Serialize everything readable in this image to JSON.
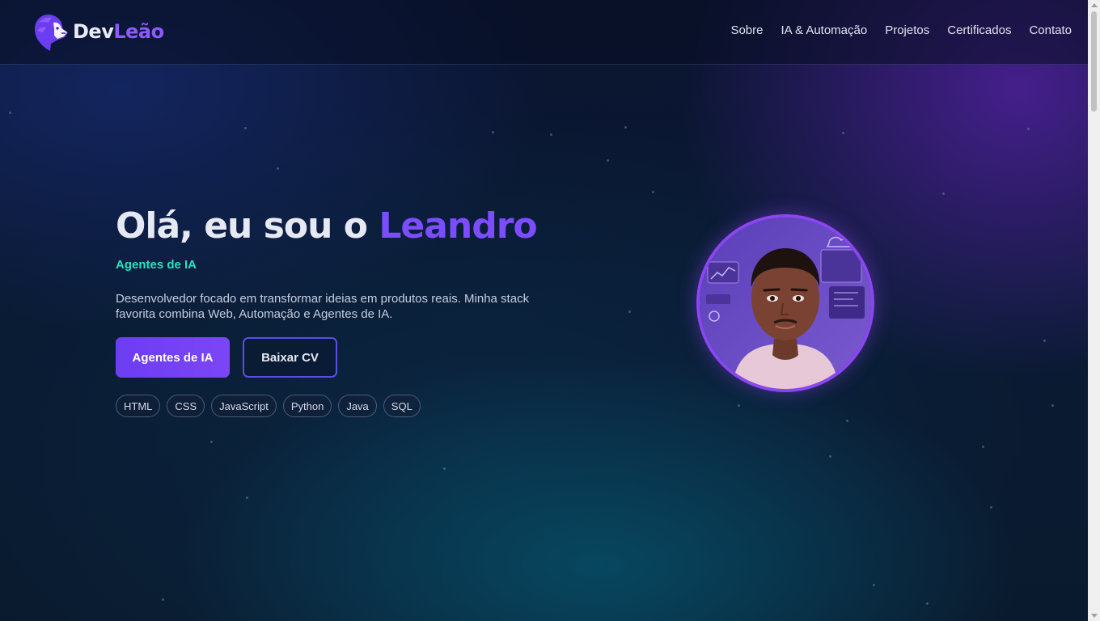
{
  "brand": {
    "name_part1": "Dev",
    "name_part2": "Leão",
    "logo_icon": "lion-icon",
    "colors": {
      "primary": "#7c4dff",
      "accent": "#2de0c0",
      "text": "#e6e9f3"
    }
  },
  "nav": {
    "items": [
      {
        "label": "Sobre"
      },
      {
        "label": "IA & Automação"
      },
      {
        "label": "Projetos"
      },
      {
        "label": "Certificados"
      },
      {
        "label": "Contato"
      }
    ]
  },
  "hero": {
    "greeting": "Olá, eu sou o ",
    "name": "Leandro",
    "subtitle": "Agentes de IA",
    "description": "Desenvolvedor focado em transformar ideias em produtos reais. Minha stack favorita combina Web, Automação e Agentes de IA.",
    "primary_button": "Agentes de IA",
    "secondary_button": "Baixar CV",
    "tags": [
      "HTML",
      "CSS",
      "JavaScript",
      "Python",
      "Java",
      "SQL"
    ],
    "avatar_icon": "developer-avatar-illustration"
  }
}
